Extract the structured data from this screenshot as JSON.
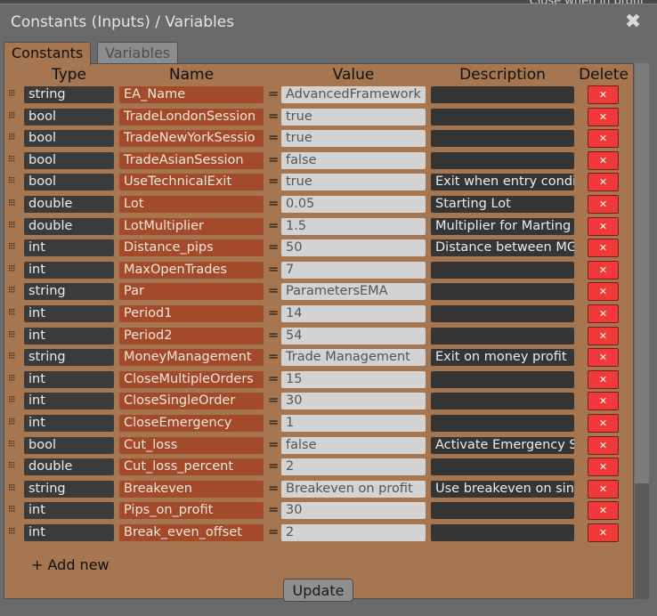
{
  "background_text": "Close when in profit",
  "dialog": {
    "title": "Constants (Inputs) / Variables",
    "close_glyph": "✖"
  },
  "tabs": [
    {
      "label": "Constants"
    },
    {
      "label": "Variables"
    }
  ],
  "columns": {
    "type": "Type",
    "name": "Name",
    "value": "Value",
    "description": "Description",
    "delete": "Delete"
  },
  "equals": "=",
  "drag_glyph": "⁝⁝⁝",
  "delete_glyph": "✕",
  "rows": [
    {
      "type": "string",
      "name": "EA_Name",
      "value": "AdvancedFramework",
      "description": ""
    },
    {
      "type": "bool",
      "name": "TradeLondonSession",
      "value": "true",
      "description": ""
    },
    {
      "type": "bool",
      "name": "TradeNewYorkSessio",
      "value": "true",
      "description": ""
    },
    {
      "type": "bool",
      "name": "TradeAsianSession",
      "value": "false",
      "description": ""
    },
    {
      "type": "bool",
      "name": "UseTechnicalExit",
      "value": "true",
      "description": "Exit when entry condi"
    },
    {
      "type": "double",
      "name": "Lot",
      "value": "0.05",
      "description": "Starting Lot"
    },
    {
      "type": "double",
      "name": "LotMultiplier",
      "value": "1.5",
      "description": "Multiplier for Marting"
    },
    {
      "type": "int",
      "name": "Distance_pips",
      "value": "50",
      "description": "Distance between MG"
    },
    {
      "type": "int",
      "name": "MaxOpenTrades",
      "value": "7",
      "description": ""
    },
    {
      "type": "string",
      "name": "Par",
      "value": "ParametersEMA",
      "description": ""
    },
    {
      "type": "int",
      "name": "Period1",
      "value": "14",
      "description": ""
    },
    {
      "type": "int",
      "name": "Period2",
      "value": "54",
      "description": ""
    },
    {
      "type": "string",
      "name": "MoneyManagement",
      "value": "Trade Management",
      "description": "Exit on money profit"
    },
    {
      "type": "int",
      "name": "CloseMultipleOrders",
      "value": "15",
      "description": ""
    },
    {
      "type": "int",
      "name": "CloseSingleOrder",
      "value": "30",
      "description": ""
    },
    {
      "type": "int",
      "name": "CloseEmergency",
      "value": "1",
      "description": ""
    },
    {
      "type": "bool",
      "name": "Cut_loss",
      "value": "false",
      "description": "Activate Emergency S"
    },
    {
      "type": "double",
      "name": "Cut_loss_percent",
      "value": "2",
      "description": ""
    },
    {
      "type": "string",
      "name": "Breakeven",
      "value": "Breakeven on profit",
      "description": "Use breakeven on sin"
    },
    {
      "type": "int",
      "name": "Pips_on_profit",
      "value": "30",
      "description": ""
    },
    {
      "type": "int",
      "name": "Break_even_offset",
      "value": "2",
      "description": ""
    }
  ],
  "add_new_label": "+ Add new",
  "update_label": "Update",
  "colors": {
    "panel": "#a5764f",
    "name_field": "#a24a2a",
    "delete_button": "#f03a3a",
    "dialog": "#6a6a6a"
  }
}
